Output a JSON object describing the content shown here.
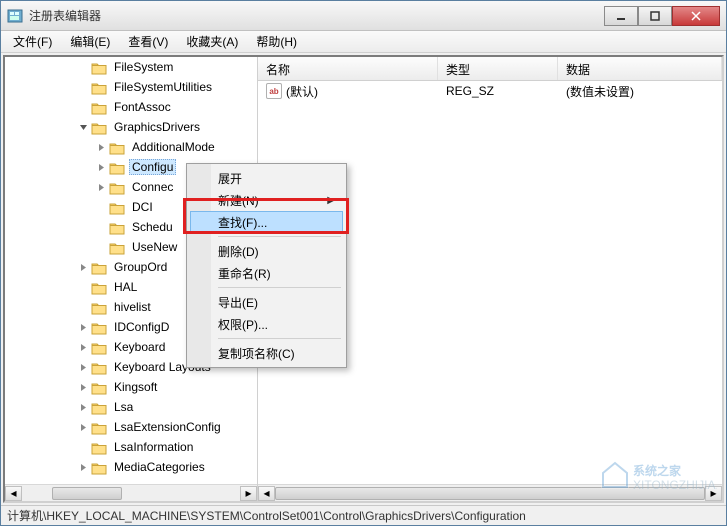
{
  "window": {
    "title": "注册表编辑器"
  },
  "menubar": [
    "文件(F)",
    "编辑(E)",
    "查看(V)",
    "收藏夹(A)",
    "帮助(H)"
  ],
  "tree": [
    {
      "indent": 4,
      "exp": "",
      "label": "FileSystem"
    },
    {
      "indent": 4,
      "exp": "",
      "label": "FileSystemUtilities"
    },
    {
      "indent": 4,
      "exp": "",
      "label": "FontAssoc"
    },
    {
      "indent": 4,
      "exp": "open",
      "label": "GraphicsDrivers"
    },
    {
      "indent": 5,
      "exp": "closed",
      "label": "AdditionalMode"
    },
    {
      "indent": 5,
      "exp": "closed",
      "label": "Configu",
      "selected": true
    },
    {
      "indent": 5,
      "exp": "closed",
      "label": "Connec"
    },
    {
      "indent": 5,
      "exp": "",
      "label": "DCI"
    },
    {
      "indent": 5,
      "exp": "",
      "label": "Schedu"
    },
    {
      "indent": 5,
      "exp": "",
      "label": "UseNew"
    },
    {
      "indent": 4,
      "exp": "closed",
      "label": "GroupOrd"
    },
    {
      "indent": 4,
      "exp": "",
      "label": "HAL"
    },
    {
      "indent": 4,
      "exp": "",
      "label": "hivelist"
    },
    {
      "indent": 4,
      "exp": "closed",
      "label": "IDConfigD"
    },
    {
      "indent": 4,
      "exp": "closed",
      "label": "Keyboard"
    },
    {
      "indent": 4,
      "exp": "closed",
      "label": "Keyboard Layouts"
    },
    {
      "indent": 4,
      "exp": "closed",
      "label": "Kingsoft"
    },
    {
      "indent": 4,
      "exp": "closed",
      "label": "Lsa"
    },
    {
      "indent": 4,
      "exp": "closed",
      "label": "LsaExtensionConfig"
    },
    {
      "indent": 4,
      "exp": "",
      "label": "LsaInformation"
    },
    {
      "indent": 4,
      "exp": "closed",
      "label": "MediaCategories"
    }
  ],
  "list": {
    "columns": {
      "name": "名称",
      "type": "类型",
      "data": "数据"
    },
    "rows": [
      {
        "name": "(默认)",
        "type": "REG_SZ",
        "data": "(数值未设置)"
      }
    ]
  },
  "context_menu": {
    "expand": "展开",
    "new": "新建(N)",
    "find": "查找(F)...",
    "delete": "删除(D)",
    "rename": "重命名(R)",
    "export": "导出(E)",
    "permissions": "权限(P)...",
    "copykey": "复制项名称(C)"
  },
  "statusbar": "计算机\\HKEY_LOCAL_MACHINE\\SYSTEM\\ControlSet001\\Control\\GraphicsDrivers\\Configuration",
  "watermark": "系统之家"
}
